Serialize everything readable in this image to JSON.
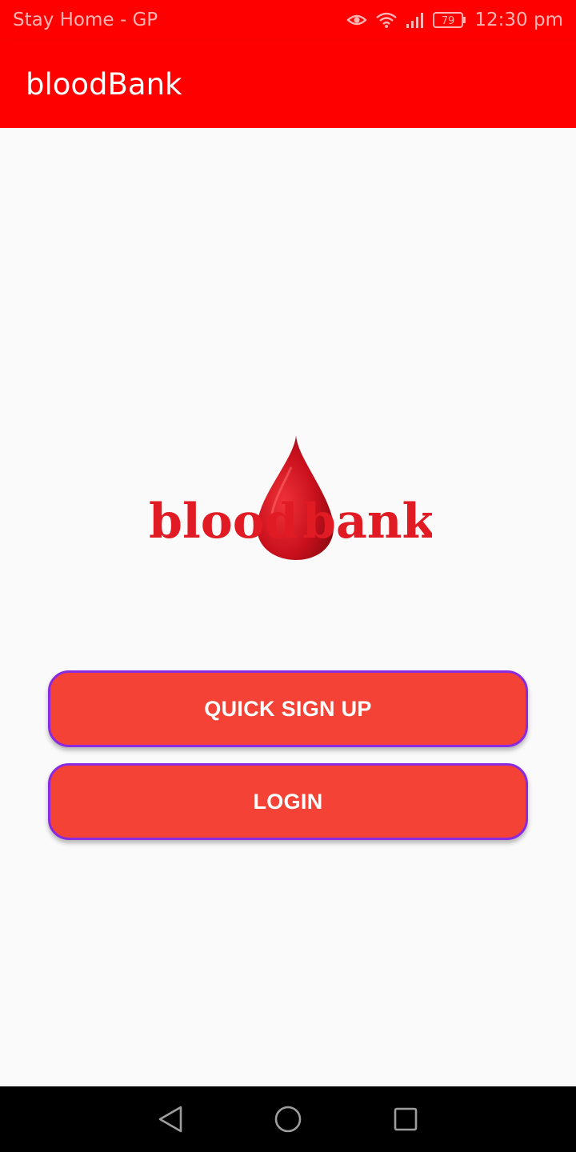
{
  "status_bar": {
    "carrier": "Stay Home - GP",
    "battery": "79",
    "time": "12:30 pm",
    "icons": [
      "eye-icon",
      "wifi-icon",
      "signal-icon",
      "battery-icon"
    ]
  },
  "app_bar": {
    "title": "bloodBank"
  },
  "logo": {
    "text_left": "blood",
    "text_right": "bank",
    "icon": "blood-drop-icon"
  },
  "buttons": {
    "signup_label": "QUICK SIGN UP",
    "login_label": "LOGIN"
  },
  "nav_bar": {
    "icons": [
      "back-icon",
      "home-icon",
      "recents-icon"
    ]
  },
  "colors": {
    "primary": "#ff0000",
    "button": "#f44336",
    "button_border": "#8a2be2",
    "background": "#fafafa",
    "logo_red": "#e01b24"
  }
}
